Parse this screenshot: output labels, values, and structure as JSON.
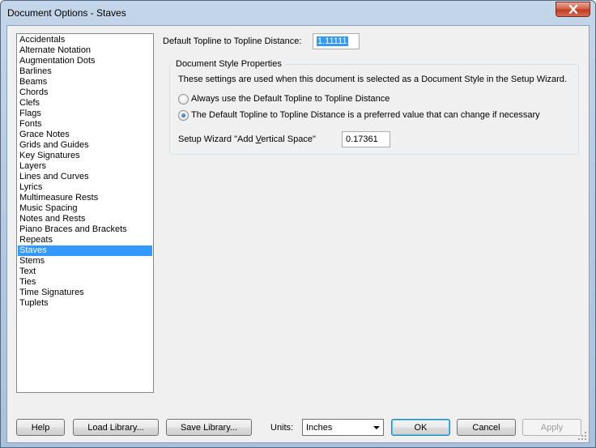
{
  "window": {
    "title": "Document Options - Staves"
  },
  "sidebar": {
    "selected_index": 20,
    "items": [
      "Accidentals",
      "Alternate Notation",
      "Augmentation Dots",
      "Barlines",
      "Beams",
      "Chords",
      "Clefs",
      "Flags",
      "Fonts",
      "Grace Notes",
      "Grids and Guides",
      "Key Signatures",
      "Layers",
      "Lines and Curves",
      "Lyrics",
      "Multimeasure Rests",
      "Music Spacing",
      "Notes and Rests",
      "Piano Braces and Brackets",
      "Repeats",
      "Staves",
      "Stems",
      "Text",
      "Ties",
      "Time Signatures",
      "Tuplets"
    ]
  },
  "main": {
    "topline_label": "Default Topline to Topline Distance:",
    "topline_value": "1.11111",
    "group_title": "Document Style Properties",
    "description": "These settings are used when this document is selected as a Document Style in the Setup Wizard.",
    "radio_always": "Always use the Default Topline to Topline Distance",
    "radio_preferred": "The Default Topline to Topline Distance is a preferred value that can change if necessary",
    "selected_radio": "preferred",
    "wizard_label_pre": "Setup Wizard \"Add ",
    "wizard_label_accel": "V",
    "wizard_label_post": "ertical Space\"",
    "wizard_value": "0.17361"
  },
  "footer": {
    "help": "Help",
    "load_library": "Load Library...",
    "save_library": "Save Library...",
    "units_label": "Units:",
    "units_value": "Inches",
    "ok": "OK",
    "cancel": "Cancel",
    "apply": "Apply"
  }
}
